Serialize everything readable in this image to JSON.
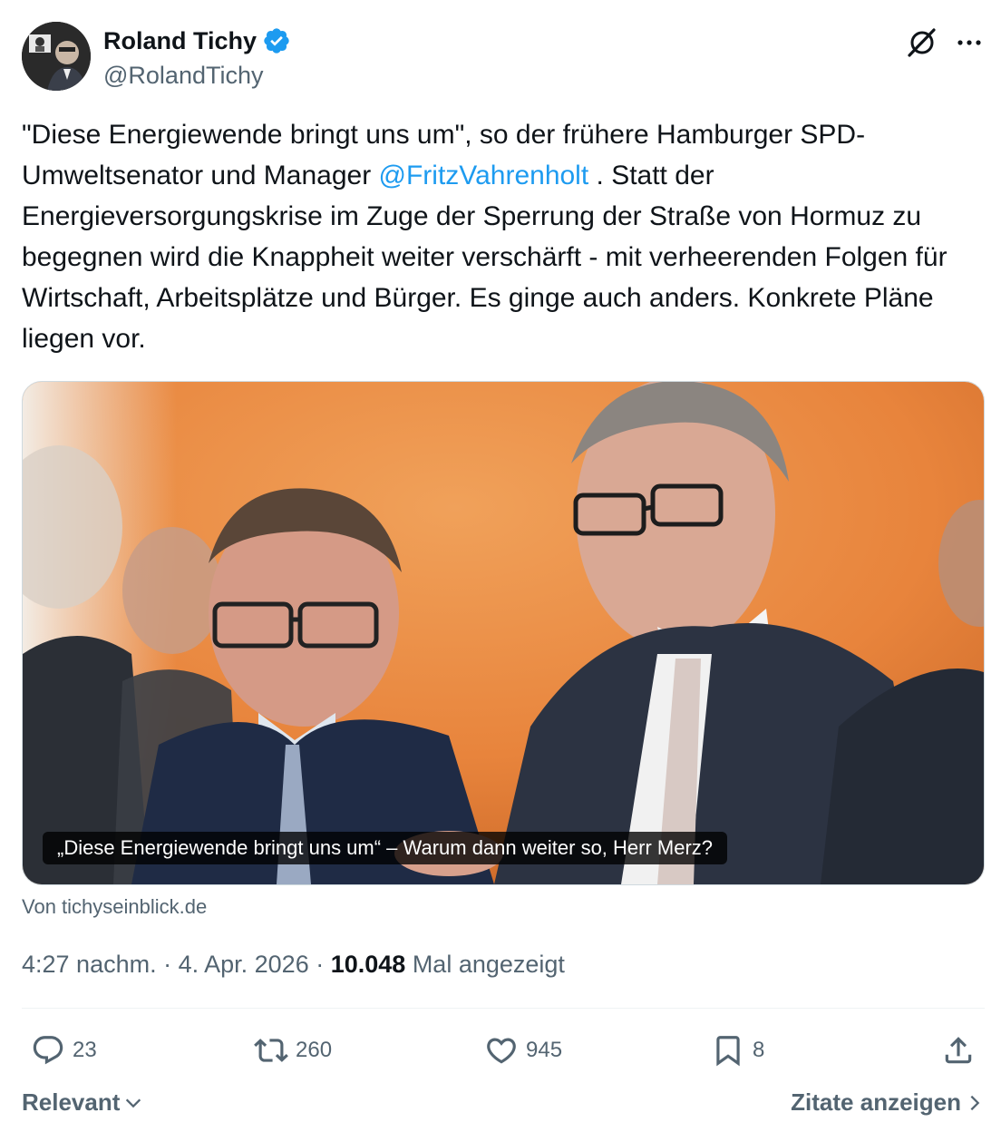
{
  "author": {
    "name": "Roland Tichy",
    "handle": "@RolandTichy",
    "verified": true,
    "verified_color": "#1d9bf0"
  },
  "header_icons": [
    "grok-icon",
    "more-icon"
  ],
  "tweet": {
    "text_part1": "\"Diese Energiewende bringt uns um\", so der frühere Hamburger SPD-Umweltsenator und Manager ",
    "mention": "@FritzVahrenholt",
    "text_part2": " . Statt der Energieversorgungskrise im Zuge der Sperrung der Straße von Hormuz zu begegnen wird die Knappheit weiter verschärft - mit verheerenden Folgen für Wirtschaft, Arbeitsplätze und Bürger. Es ginge auch anders. Konkrete Pläne liegen vor."
  },
  "card": {
    "caption": "„Diese Energiewende bringt uns um“ – Warum dann weiter so, Herr Merz?",
    "source": "Von tichyseinblick.de"
  },
  "meta": {
    "time": "4:27 nachm.",
    "separator": " · ",
    "date": "4. Apr. 2026",
    "views_count": "10.048",
    "views_label": " Mal angezeigt"
  },
  "actions": {
    "replies": "23",
    "reposts": "260",
    "likes": "945",
    "bookmarks": "8"
  },
  "footer": {
    "sort_label": "Relevant",
    "quotes_label": "Zitate anzeigen"
  },
  "colors": {
    "text": "#0f1419",
    "secondary": "#536471",
    "link": "#1d9bf0",
    "border": "#cfd9de"
  }
}
